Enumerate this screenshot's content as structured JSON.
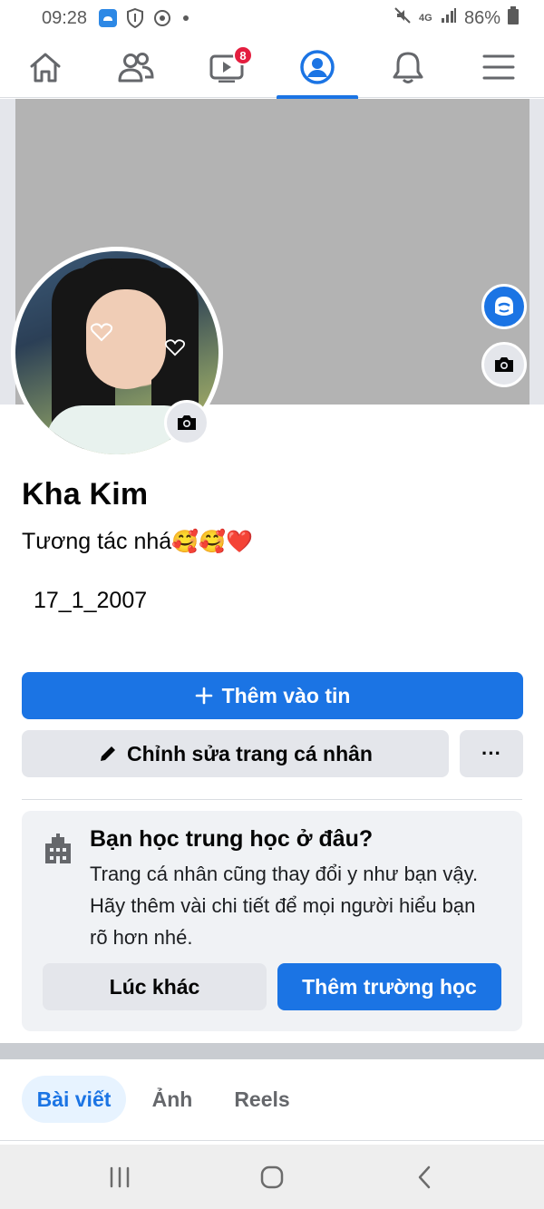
{
  "status_bar": {
    "time": "09:28",
    "network": "4G",
    "battery": "86%"
  },
  "nav": {
    "items": [
      {
        "name": "home-icon"
      },
      {
        "name": "friends-icon"
      },
      {
        "name": "watch-icon",
        "badge": "8"
      },
      {
        "name": "profile-icon",
        "active": true
      },
      {
        "name": "bell-icon"
      },
      {
        "name": "menu-icon"
      }
    ],
    "accent": "#1b74e4"
  },
  "profile": {
    "name": "Kha Kim",
    "bio": "Tương tác nhá",
    "bio_emoji": "🥰🥰❤️",
    "dob": "17_1_2007"
  },
  "actions": {
    "add_story": "Thêm vào tin",
    "edit_profile": "Chỉnh sửa trang cá nhân",
    "more": "···"
  },
  "school_card": {
    "title": "Bạn học trung học ở đâu?",
    "body": "Trang cá nhân cũng thay đổi y như bạn vậy. Hãy thêm vài chi tiết để mọi người hiểu bạn rõ hơn nhé.",
    "later": "Lúc khác",
    "add_school": "Thêm trường học"
  },
  "tabs": {
    "posts": "Bài viết",
    "photos": "Ảnh",
    "reels": "Reels"
  }
}
